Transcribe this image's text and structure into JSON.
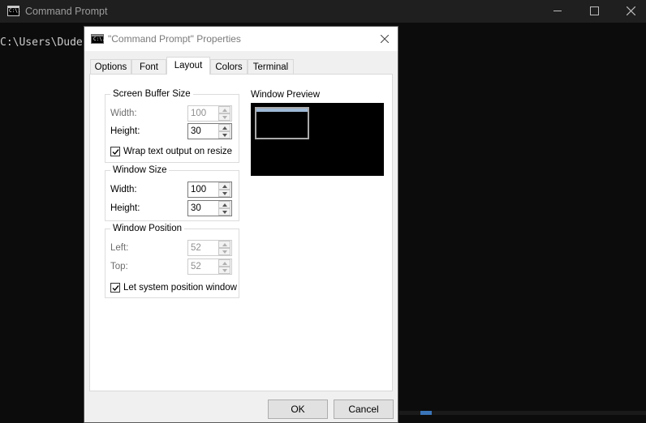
{
  "console": {
    "title": "Command Prompt",
    "icon": "console-app-icon",
    "icon_text": "C:\\.",
    "prompt_text": "C:\\Users\\Dude"
  },
  "dialog": {
    "title": "\"Command Prompt\" Properties",
    "tabs": [
      {
        "label": "Options"
      },
      {
        "label": "Font"
      },
      {
        "label": "Layout"
      },
      {
        "label": "Colors"
      },
      {
        "label": "Terminal"
      }
    ],
    "active_tab": "Layout",
    "screen_buffer": {
      "title": "Screen Buffer Size",
      "width_label": "Width:",
      "width_value": "100",
      "height_label": "Height:",
      "height_value": "30",
      "wrap_label": "Wrap text output on resize",
      "wrap_checked": true
    },
    "window_size": {
      "title": "Window Size",
      "width_label": "Width:",
      "width_value": "100",
      "height_label": "Height:",
      "height_value": "30"
    },
    "window_position": {
      "title": "Window Position",
      "left_label": "Left:",
      "left_value": "52",
      "top_label": "Top:",
      "top_value": "52",
      "system_label": "Let system position window",
      "system_checked": true
    },
    "preview_label": "Window Preview",
    "ok_label": "OK",
    "cancel_label": "Cancel"
  },
  "colors": {
    "console_bg": "#0c0c0c",
    "console_titlebar": "#1f1f1f",
    "dialog_bg": "#f0f0f0",
    "panel_bg": "#ffffff",
    "preview_bg": "#000000"
  }
}
